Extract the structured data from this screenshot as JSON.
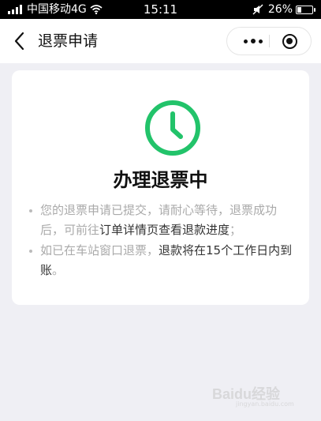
{
  "status_bar": {
    "carrier": "中国移动4G",
    "time": "15:11",
    "battery": "26%",
    "battery_level": 0.26
  },
  "navbar": {
    "back_icon": "chevron-left-icon",
    "title": "退票申请",
    "more_icon": "more-dots-icon",
    "close_icon": "target-close-icon"
  },
  "card": {
    "status_icon": "clock-icon",
    "status_color": "#22c36a",
    "title": "办理退票中",
    "bullet1": {
      "part1": "您的退票申请已提交，请耐心等待，退票成功后，可前往",
      "part2": "订单详情页查看退款进度",
      "part3": "；"
    },
    "bullet2": {
      "part1": "如已在车站窗口退票，",
      "part2": "退款将在15个工作日内到账",
      "part3": "。"
    }
  },
  "watermark": {
    "text": "Baidu经验",
    "sub": "jingyan.baidu.com"
  }
}
